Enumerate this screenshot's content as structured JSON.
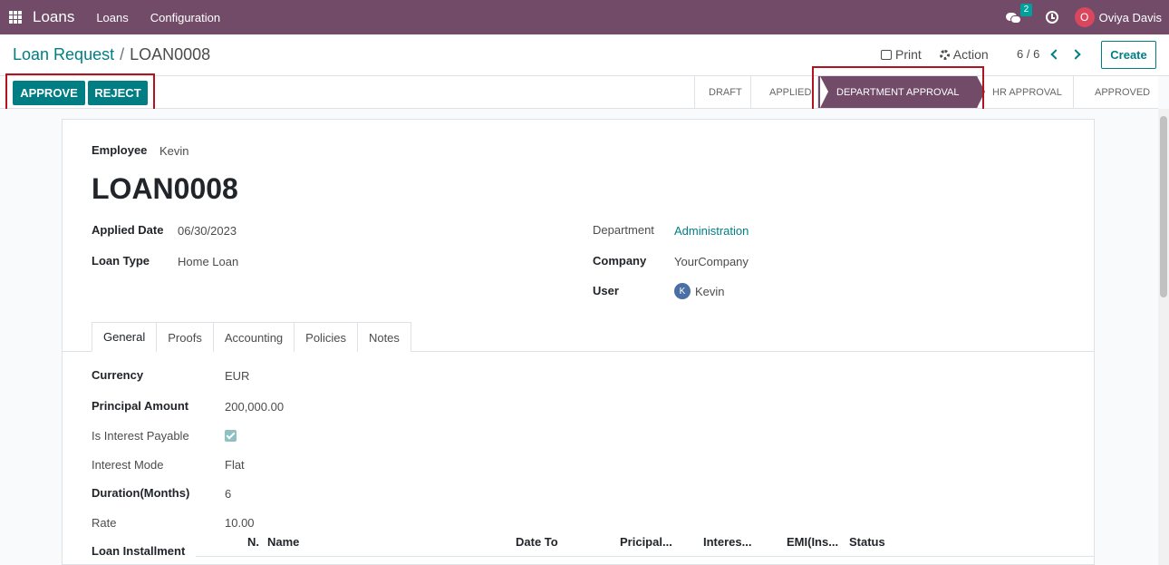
{
  "navbar": {
    "app_name": "Loans",
    "menu": [
      "Loans",
      "Configuration"
    ],
    "chat_count": "2",
    "user_initial": "O",
    "user_name": "Oviya Davis"
  },
  "breadcrumb": {
    "parent": "Loan Request",
    "separator": "/",
    "current": "LOAN0008"
  },
  "actions": {
    "print": "Print",
    "action": "Action",
    "pager": "6 / 6",
    "create": "Create"
  },
  "buttons": {
    "approve": "APPROVE",
    "reject": "REJECT"
  },
  "stages": [
    "DRAFT",
    "APPLIED",
    "DEPARTMENT APPROVAL",
    "HR APPROVAL",
    "APPROVED"
  ],
  "active_stage": "DEPARTMENT APPROVAL",
  "form": {
    "employee_label": "Employee",
    "employee": "Kevin",
    "title": "LOAN0008",
    "applied_date_label": "Applied Date",
    "applied_date": "06/30/2023",
    "loan_type_label": "Loan Type",
    "loan_type": "Home Loan",
    "department_label": "Department",
    "department": "Administration",
    "company_label": "Company",
    "company": "YourCompany",
    "user_label": "User",
    "user_initial": "K",
    "user": "Kevin"
  },
  "tabs": [
    "General",
    "Proofs",
    "Accounting",
    "Policies",
    "Notes"
  ],
  "general": {
    "currency_label": "Currency",
    "currency": "EUR",
    "principal_label": "Principal Amount",
    "principal": "200,000.00",
    "interest_payable_label": "Is Interest Payable",
    "interest_payable": true,
    "interest_mode_label": "Interest Mode",
    "interest_mode": "Flat",
    "duration_label": "Duration(Months)",
    "duration": "6",
    "rate_label": "Rate",
    "rate": "10.00",
    "installment_label": "Loan Installment"
  },
  "installment_columns": [
    "N.",
    "Name",
    "Date To",
    "Pricipal...",
    "Interes...",
    "EMI(Ins...",
    "Status"
  ],
  "colors": {
    "brand": "#714b67",
    "accent": "#017e84",
    "highlight": "#b3121f"
  }
}
